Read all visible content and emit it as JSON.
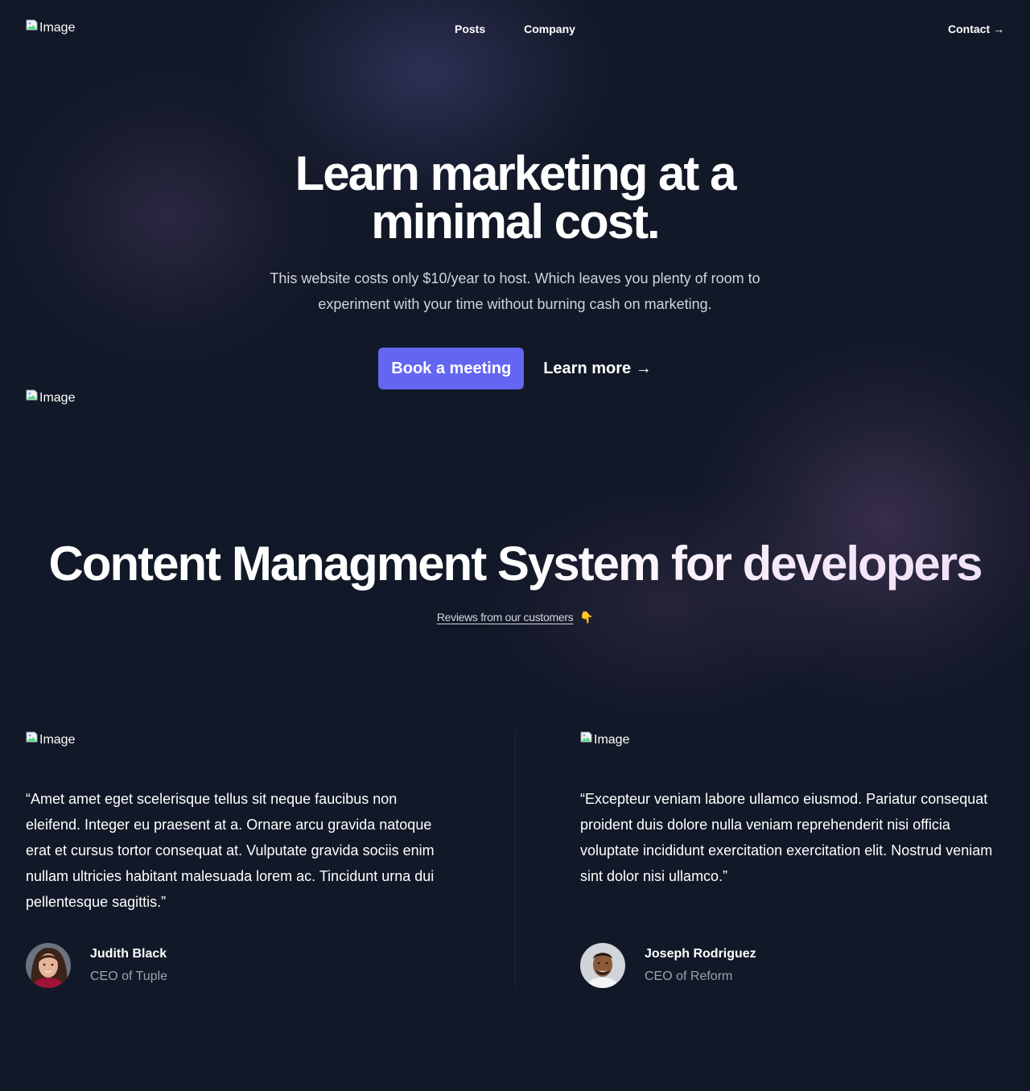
{
  "colors": {
    "background": "#111827",
    "accent": "#6366f1",
    "muted_text": "#9ca3af",
    "body_text": "#d1d5db"
  },
  "header": {
    "logo_alt": "Image",
    "nav": [
      "Posts",
      "Company"
    ],
    "contact_label": "Contact →"
  },
  "hero": {
    "title": "Learn marketing at a minimal cost.",
    "subtitle": "This website costs only $10/year to host. Which leaves you plenty of room to experiment with your time without burning cash on marketing.",
    "primary_button": "Book a meeting",
    "secondary_link": "Learn more →",
    "image_alt": "Image"
  },
  "cms": {
    "title": "Content Managment System for developers",
    "reviews_link": "Reviews from our customers",
    "reviews_emoji": "👇"
  },
  "testimonials": [
    {
      "logo_alt": "Image",
      "quote": "“Amet amet eget scelerisque tellus sit neque faucibus non eleifend. Integer eu praesent at a. Ornare arcu gravida natoque erat et cursus tortor consequat at. Vulputate gravida sociis enim nullam ultricies habitant malesuada lorem ac. Tincidunt urna dui pellentesque sagittis.”",
      "name": "Judith Black",
      "role": "CEO of Tuple"
    },
    {
      "logo_alt": "Image",
      "quote": "“Excepteur veniam labore ullamco eiusmod. Pariatur consequat proident duis dolore nulla veniam reprehenderit nisi officia voluptate incididunt exercitation exercitation elit. Nostrud veniam sint dolor nisi ullamco.”",
      "name": "Joseph Rodriguez",
      "role": "CEO of Reform"
    }
  ]
}
